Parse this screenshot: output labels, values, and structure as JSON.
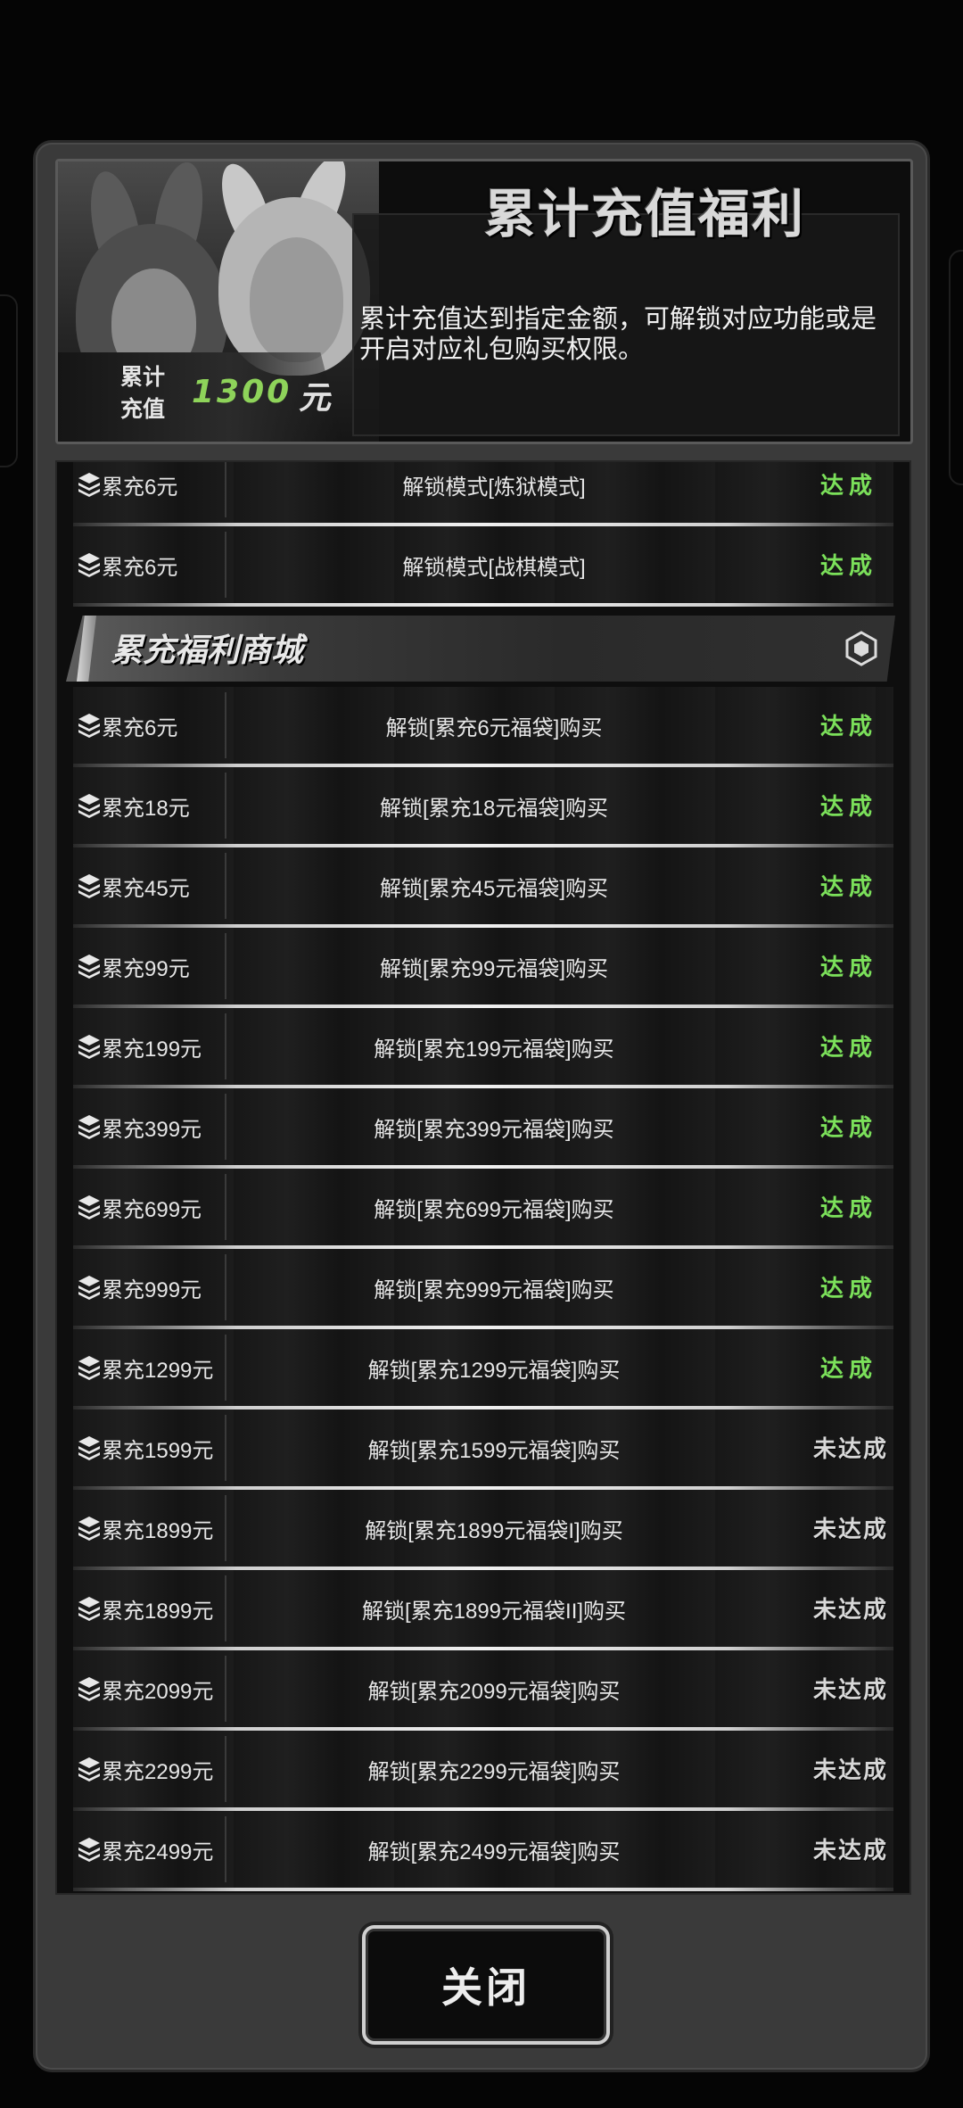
{
  "header": {
    "title": "累计充值福利",
    "description": "累计充值达到指定金额，可解锁对应功能或是开启对应礼包购买权限。",
    "badge_label_line1": "累计",
    "badge_label_line2": "充值",
    "badge_amount": "1300",
    "badge_unit": "元"
  },
  "unlock_rows": [
    {
      "requirement": "累充6元",
      "description": "解锁模式[炼狱模式]",
      "status": "达成",
      "achieved": true
    },
    {
      "requirement": "累充6元",
      "description": "解锁模式[战棋模式]",
      "status": "达成",
      "achieved": true
    }
  ],
  "section": {
    "title": "累充福利商城"
  },
  "shop_rows": [
    {
      "requirement": "累充6元",
      "description": "解锁[累充6元福袋]购买",
      "status": "达成",
      "achieved": true
    },
    {
      "requirement": "累充18元",
      "description": "解锁[累充18元福袋]购买",
      "status": "达成",
      "achieved": true
    },
    {
      "requirement": "累充45元",
      "description": "解锁[累充45元福袋]购买",
      "status": "达成",
      "achieved": true
    },
    {
      "requirement": "累充99元",
      "description": "解锁[累充99元福袋]购买",
      "status": "达成",
      "achieved": true
    },
    {
      "requirement": "累充199元",
      "description": "解锁[累充199元福袋]购买",
      "status": "达成",
      "achieved": true
    },
    {
      "requirement": "累充399元",
      "description": "解锁[累充399元福袋]购买",
      "status": "达成",
      "achieved": true
    },
    {
      "requirement": "累充699元",
      "description": "解锁[累充699元福袋]购买",
      "status": "达成",
      "achieved": true
    },
    {
      "requirement": "累充999元",
      "description": "解锁[累充999元福袋]购买",
      "status": "达成",
      "achieved": true
    },
    {
      "requirement": "累充1299元",
      "description": "解锁[累充1299元福袋]购买",
      "status": "达成",
      "achieved": true
    },
    {
      "requirement": "累充1599元",
      "description": "解锁[累充1599元福袋]购买",
      "status": "未达成",
      "achieved": false
    },
    {
      "requirement": "累充1899元",
      "description": "解锁[累充1899元福袋I]购买",
      "status": "未达成",
      "achieved": false
    },
    {
      "requirement": "累充1899元",
      "description": "解锁[累充1899元福袋II]购买",
      "status": "未达成",
      "achieved": false
    },
    {
      "requirement": "累充2099元",
      "description": "解锁[累充2099元福袋]购买",
      "status": "未达成",
      "achieved": false
    },
    {
      "requirement": "累充2299元",
      "description": "解锁[累充2299元福袋]购买",
      "status": "未达成",
      "achieved": false
    },
    {
      "requirement": "累充2499元",
      "description": "解锁[累充2499元福袋]购买",
      "status": "未达成",
      "achieved": false
    }
  ],
  "close_button": {
    "label": "关闭"
  },
  "colors": {
    "achieved": "#7be05a",
    "pending": "#d8d8d8",
    "amount": "#8ed35a"
  },
  "icons": {
    "row": "layers-icon",
    "section": "hexagon-icon"
  }
}
